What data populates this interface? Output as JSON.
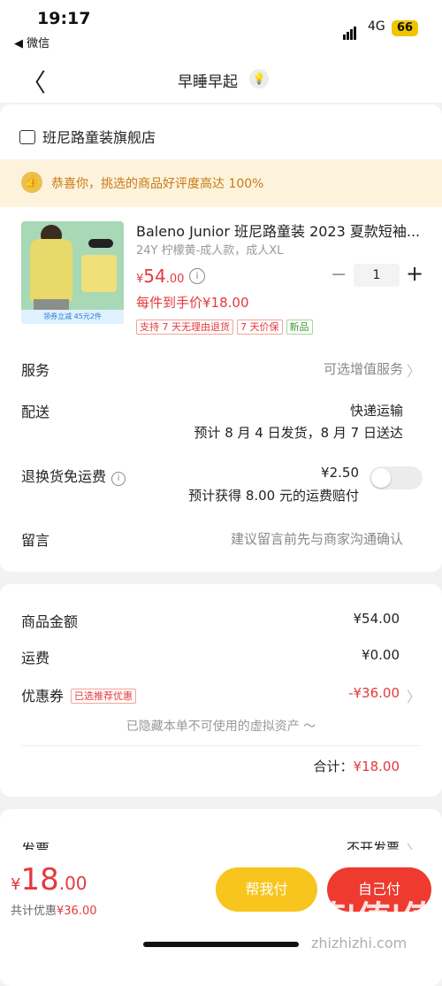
{
  "status_bar": {
    "time": "19:17",
    "back_app": "◀ 微信",
    "network": "4G",
    "battery": "66"
  },
  "nav": {
    "back_icon": "chevron-left-icon",
    "title": "早睡早起",
    "title_icon": "bulb-icon"
  },
  "shop": {
    "name": "班尼路童装旗舰店",
    "icon": "store-icon"
  },
  "congrats": {
    "text": "恭喜你，挑选的商品好评度高达 100%",
    "icon": "thumbs-up-icon"
  },
  "product": {
    "title": "Baleno Junior 班尼路童装 2023 夏款短袖...",
    "spec": "24Y 柠檬黄-成人款，成人XL",
    "price_currency": "¥",
    "price_int": "54",
    "price_dec": ".00",
    "unit_price": "每件到手价¥18.00",
    "tags": [
      "支持 7 天无理由退货",
      "7 天价保"
    ],
    "new_tag": "新品",
    "quantity": "1",
    "image_promo": "领券立减 45元2件"
  },
  "rows": {
    "service": {
      "label": "服务",
      "value": "可选增值服务"
    },
    "delivery": {
      "label": "配送",
      "method": "快递运输",
      "eta": "预计 8 月 4 日发货，8 月 7 日送达"
    },
    "return_shipping": {
      "label": "退换货免运费",
      "price": "¥2.50",
      "note": "预计获得 8.00 元的运费赔付",
      "toggle_on": false
    },
    "message": {
      "label": "留言",
      "placeholder": "建议留言前先与商家沟通确认"
    }
  },
  "summary": {
    "goods_label": "商品金额",
    "goods_value": "¥54.00",
    "shipping_label": "运费",
    "shipping_value": "¥0.00",
    "coupon_label": "优惠券",
    "coupon_badge": "已选推荐优惠",
    "coupon_value": "-¥36.00",
    "hidden_note": "已隐藏本单不可使用的虚拟资产 〜",
    "total_label": "合计：",
    "total_value": "¥18.00"
  },
  "invoice": {
    "label": "发票",
    "value": "不开发票"
  },
  "footer": {
    "total_currency": "¥",
    "total_int": "18",
    "total_dec": ".00",
    "save_prefix": "共计优惠",
    "save_value": "¥36.00",
    "help_button": "帮我付",
    "pay_button": "自己付",
    "watermark": "值|值|值",
    "watermark_sub": "zhizhizhi.com"
  },
  "colors": {
    "accent_red": "#e4393c",
    "help_yellow": "#f7c51e",
    "pay_red": "#ee3a2f",
    "congrats_bg": "#fdf3dd"
  }
}
